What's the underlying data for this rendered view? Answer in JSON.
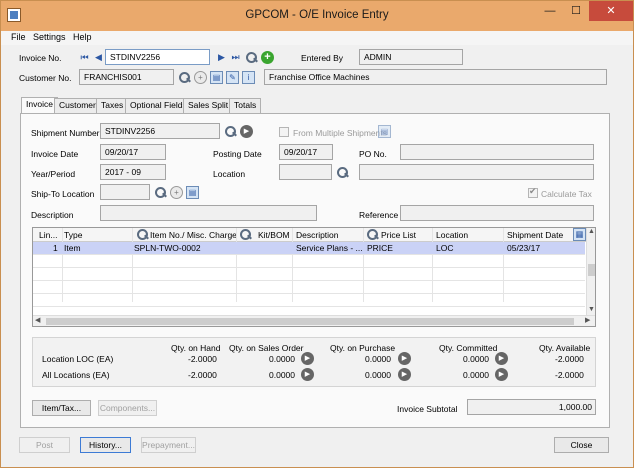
{
  "window": {
    "title": "GPCOM - O/E Invoice Entry",
    "minimize": "—",
    "maximize": "☐",
    "close": "✕"
  },
  "menu": [
    "File",
    "Settings",
    "Help"
  ],
  "header": {
    "invoice_no_label": "Invoice No.",
    "invoice_no": "STDINV2256",
    "entered_by_label": "Entered By",
    "entered_by": "ADMIN",
    "customer_no_label": "Customer No.",
    "customer_no": "FRANCHIS001",
    "customer_name": "Franchise Office Machines"
  },
  "tabs": [
    "Invoice",
    "Customer",
    "Taxes",
    "Optional Fields",
    "Sales Split",
    "Totals"
  ],
  "invoice": {
    "shipment_number_label": "Shipment Number",
    "shipment_number": "STDINV2256",
    "from_multiple_label": "From Multiple Shipments",
    "invoice_date_label": "Invoice Date",
    "invoice_date": "09/20/17",
    "posting_date_label": "Posting Date",
    "posting_date": "09/20/17",
    "po_no_label": "PO No.",
    "year_period_label": "Year/Period",
    "year_period": "2017 - 09",
    "location_label": "Location",
    "ship_to_label": "Ship-To Location",
    "calculate_tax_label": "Calculate Tax",
    "description_label": "Description",
    "reference_label": "Reference"
  },
  "grid": {
    "columns": [
      "Lin...",
      "Type",
      "Item No./ Misc. Charge",
      "Kit/BOM",
      "Description",
      "Price List",
      "Location",
      "Shipment Date"
    ],
    "rows": [
      {
        "line": "1",
        "type": "Item",
        "item": "SPLN-TWO-0002",
        "kit": "",
        "desc": "Service Plans - ...",
        "price_list": "PRICE",
        "location": "LOC",
        "ship_date": "05/23/17"
      }
    ]
  },
  "stock": {
    "headers": [
      "Qty. on Hand",
      "Qty. on Sales Order",
      "Qty. on Purchase",
      "Qty. Committed",
      "Qty. Available"
    ],
    "rows": [
      {
        "label": "Location  LOC (EA)",
        "values": [
          "-2.0000",
          "0.0000",
          "0.0000",
          "0.0000",
          "-2.0000"
        ]
      },
      {
        "label": "All Locations (EA)",
        "values": [
          "-2.0000",
          "0.0000",
          "0.0000",
          "0.0000",
          "-2.0000"
        ]
      }
    ]
  },
  "buttons": {
    "item_tax": "Item/Tax...",
    "components": "Components...",
    "post": "Post",
    "history": "History...",
    "prepayment": "Prepayment...",
    "close": "Close"
  },
  "subtotal": {
    "label": "Invoice Subtotal",
    "value": "1,000.00"
  }
}
